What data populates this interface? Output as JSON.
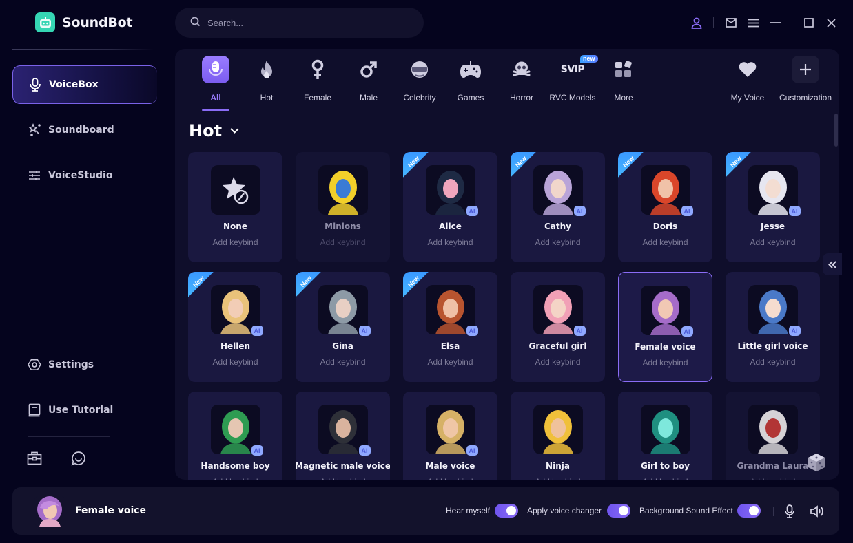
{
  "app": {
    "name": "SoundBot",
    "brand_color": "#35d6b4",
    "accent_color": "#8a6cf5"
  },
  "sidebar": {
    "items": [
      {
        "label": "VoiceBox",
        "icon": "microphone-icon",
        "active": true
      },
      {
        "label": "Soundboard",
        "icon": "magic-wand-icon",
        "active": false
      },
      {
        "label": "VoiceStudio",
        "icon": "sliders-icon",
        "active": false
      }
    ],
    "bottom_items": [
      {
        "label": "Settings",
        "icon": "settings-icon"
      },
      {
        "label": "Use Tutorial",
        "icon": "book-icon"
      }
    ],
    "footer_icons": [
      "toolbox-icon",
      "chat-icon"
    ]
  },
  "topbar": {
    "search": {
      "placeholder": "Search...",
      "value": ""
    },
    "controls": [
      "account-icon",
      "mail-icon",
      "menu-icon",
      "minimize-icon",
      "maximize-icon",
      "close-icon"
    ]
  },
  "categories": [
    {
      "label": "All",
      "icon": "microphone-icon",
      "active": true
    },
    {
      "label": "Hot",
      "icon": "flame-icon"
    },
    {
      "label": "Female",
      "icon": "female-icon"
    },
    {
      "label": "Male",
      "icon": "male-icon"
    },
    {
      "label": "Celebrity",
      "icon": "sunglasses-icon"
    },
    {
      "label": "Games",
      "icon": "gamepad-icon"
    },
    {
      "label": "Horror",
      "icon": "skull-icon"
    },
    {
      "label": "RVC Models",
      "icon": "svip-icon",
      "badge": "new",
      "icon_text": "SVIP"
    },
    {
      "label": "More",
      "icon": "grid-icon"
    }
  ],
  "right_actions": [
    {
      "label": "My Voice",
      "icon": "heart-icon"
    },
    {
      "label": "Customization",
      "icon": "plus-icon"
    }
  ],
  "section": {
    "title": "Hot"
  },
  "voices": [
    {
      "name": "None",
      "keybind": "Add keybind",
      "is_new": false,
      "ai": false,
      "dim": false
    },
    {
      "name": "Minions",
      "keybind": "Add keybind",
      "is_new": false,
      "ai": false,
      "dim": true
    },
    {
      "name": "Alice",
      "keybind": "Add keybind",
      "is_new": true,
      "ai": true
    },
    {
      "name": "Cathy",
      "keybind": "Add keybind",
      "is_new": true,
      "ai": true
    },
    {
      "name": "Doris",
      "keybind": "Add keybind",
      "is_new": true,
      "ai": true
    },
    {
      "name": "Jesse",
      "keybind": "Add keybind",
      "is_new": true,
      "ai": true
    },
    {
      "name": "Hellen",
      "keybind": "Add keybind",
      "is_new": true,
      "ai": true
    },
    {
      "name": "Gina",
      "keybind": "Add keybind",
      "is_new": true,
      "ai": true
    },
    {
      "name": "Elsa",
      "keybind": "Add keybind",
      "is_new": true,
      "ai": true
    },
    {
      "name": "Graceful girl",
      "keybind": "Add keybind",
      "is_new": false,
      "ai": true
    },
    {
      "name": "Female voice",
      "keybind": "Add keybind",
      "is_new": false,
      "ai": true,
      "selected": true
    },
    {
      "name": "Little girl voice",
      "keybind": "Add keybind",
      "is_new": false,
      "ai": true
    },
    {
      "name": "Handsome boy",
      "keybind": "Add keybind",
      "is_new": false,
      "ai": true
    },
    {
      "name": "Magnetic male voice",
      "keybind": "Add keybind",
      "is_new": false,
      "ai": true
    },
    {
      "name": "Male voice",
      "keybind": "Add keybind",
      "is_new": false,
      "ai": true
    },
    {
      "name": "Ninja",
      "keybind": "Add keybind",
      "is_new": false,
      "ai": false
    },
    {
      "name": "Girl to boy",
      "keybind": "Add keybind",
      "is_new": false,
      "ai": false
    },
    {
      "name": "Grandma Laura",
      "keybind": "Add keybind",
      "is_new": false,
      "ai": false,
      "dim": true
    }
  ],
  "labels": {
    "new_ribbon": "New",
    "ai_badge": "AI"
  },
  "bottom_bar": {
    "current_voice": "Female voice",
    "toggles": [
      {
        "label": "Hear myself",
        "on": true
      },
      {
        "label": "Apply voice changer",
        "on": true
      },
      {
        "label": "Background Sound Effect",
        "on": true
      }
    ],
    "icons": [
      "microphone-icon",
      "speaker-icon"
    ]
  }
}
